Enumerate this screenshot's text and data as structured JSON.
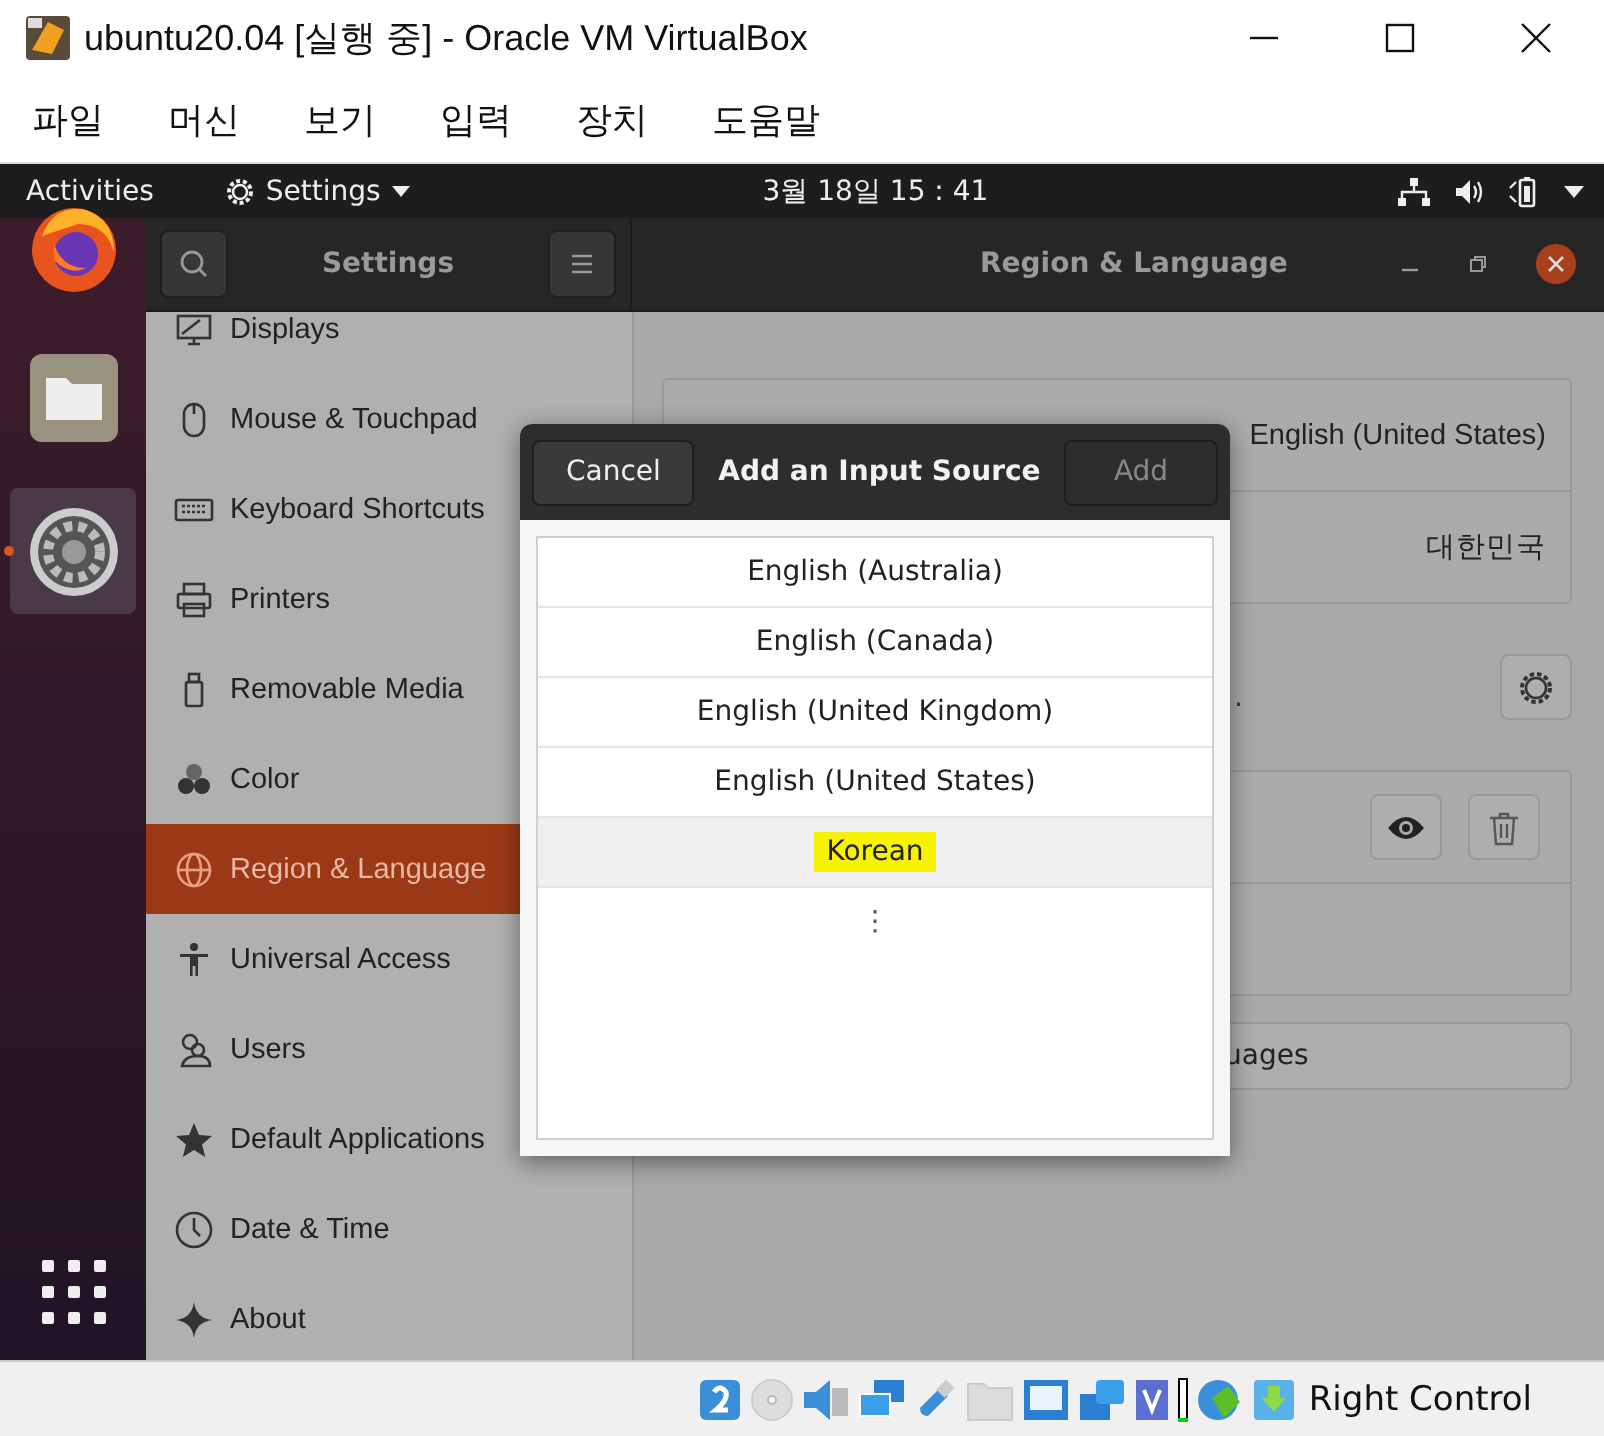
{
  "window": {
    "title": "ubuntu20.04 [실행 중] - Oracle VM VirtualBox"
  },
  "menu": [
    "파일",
    "머신",
    "보기",
    "입력",
    "장치",
    "도움말"
  ],
  "top_bar": {
    "activities": "Activities",
    "app": "Settings",
    "clock": "3월 18일  15 : 41"
  },
  "dock": [
    {
      "kind": "firefox",
      "active": false
    },
    {
      "kind": "files",
      "active": false
    },
    {
      "kind": "settings",
      "active": true
    }
  ],
  "settings": {
    "title": "Settings",
    "panel_title": "Region & Language"
  },
  "sidebar": {
    "items": [
      {
        "label": "Displays",
        "selected": false
      },
      {
        "label": "Mouse & Touchpad",
        "selected": false
      },
      {
        "label": "Keyboard Shortcuts",
        "selected": false
      },
      {
        "label": "Printers",
        "selected": false
      },
      {
        "label": "Removable Media",
        "selected": false
      },
      {
        "label": "Color",
        "selected": false
      },
      {
        "label": "Region & Language",
        "selected": true
      },
      {
        "label": "Universal Access",
        "selected": false
      },
      {
        "label": "Users",
        "selected": false
      },
      {
        "label": "Default Applications",
        "selected": false
      },
      {
        "label": "Date & Time",
        "selected": false
      },
      {
        "label": "About",
        "selected": false
      }
    ]
  },
  "content": {
    "language": "English (United States)",
    "formats": "대한민국",
    "hint_fragment": ".",
    "button_fragment": "uages"
  },
  "dialog": {
    "cancel": "Cancel",
    "title": "Add an Input Source",
    "add": "Add",
    "add_disabled": true,
    "items": [
      {
        "label": "English (Australia)",
        "selected": false,
        "highlighted": false
      },
      {
        "label": "English (Canada)",
        "selected": false,
        "highlighted": false
      },
      {
        "label": "English (United Kingdom)",
        "selected": false,
        "highlighted": false
      },
      {
        "label": "English (United States)",
        "selected": false,
        "highlighted": false
      },
      {
        "label": "Korean",
        "selected": true,
        "highlighted": true
      }
    ],
    "more": "⋮"
  },
  "status_bar": {
    "host_key": "Right Control"
  }
}
